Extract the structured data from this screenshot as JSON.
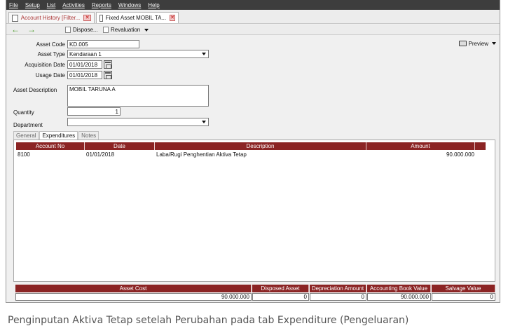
{
  "menu": [
    "File",
    "Setup",
    "List",
    "Activities",
    "Reports",
    "Windows",
    "Help"
  ],
  "tabs": [
    {
      "label": "Account History [Filter...",
      "active": false
    },
    {
      "label": "Fixed Asset MOBIL TA...",
      "active": true
    }
  ],
  "toolbar": {
    "dispose_label": "Dispose...",
    "revaluation_label": "Revaluation"
  },
  "preview": {
    "label": "Preview"
  },
  "form": {
    "asset_code_label": "Asset Code",
    "asset_code": "KD.005",
    "asset_type_label": "Asset Type",
    "asset_type": "Kendaraan 1",
    "acquisition_date_label": "Acquisition Date",
    "acquisition_date": "01/01/2018",
    "usage_date_label": "Usage Date",
    "usage_date": "01/01/2018",
    "asset_description_label": "Asset Description",
    "asset_description": "MOBIL TARUNA A",
    "quantity_label": "Quantity",
    "quantity": "1",
    "department_label": "Department",
    "department": ""
  },
  "subtabs": [
    {
      "label": "General",
      "active": false
    },
    {
      "label": "Expenditures",
      "active": true
    },
    {
      "label": "Notes",
      "active": false
    }
  ],
  "grid": {
    "columns": [
      "Account No",
      "Date",
      "Description",
      "Amount"
    ],
    "rows": [
      {
        "account_no": "8100",
        "date": "01/01/2018",
        "description": "Laba/Rugi Penghentian Aktiva Tetap",
        "amount": "90.000.000"
      }
    ]
  },
  "footer": {
    "asset_cost_label": "Asset Cost",
    "asset_cost": "90.000.000",
    "disposed_asset_label": "Disposed Asset",
    "disposed_asset": "0",
    "depreciation_amount_label": "Depreciation Amount",
    "depreciation_amount": "0",
    "accounting_book_value_label": "Accounting Book Value",
    "accounting_book_value": "90.000.000",
    "salvage_value_label": "Salvage Value",
    "salvage_value": "0"
  },
  "caption": "Penginputan Aktiva Tetap setelah Perubahan pada tab Expenditure (Pengeluaran)",
  "colors": {
    "header_red": "#8b2424",
    "menubar": "#3d3d3d",
    "nav_green": "#4a9a2a"
  }
}
